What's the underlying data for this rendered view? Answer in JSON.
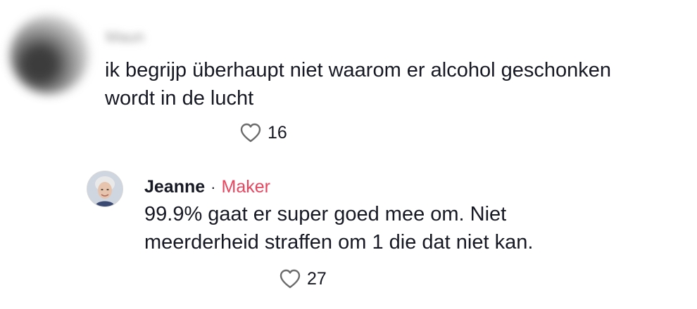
{
  "comments": [
    {
      "username": "Maun",
      "text_lines": [
        "ik begrijp überhaupt niet waarom er alcohol geschonken",
        "wordt in de lucht"
      ],
      "likes": "16",
      "avatar_icon": "user-avatar-blurred"
    },
    {
      "username": "Jeanne",
      "separator": "·",
      "badge": "Maker",
      "text_lines": [
        "99.9% gaat er super goed mee om. Niet",
        "meerderheid straffen om 1 die dat niet kan."
      ],
      "likes": "27",
      "avatar_icon": "user-avatar-photo"
    }
  ],
  "colors": {
    "text": "#161823",
    "creator_badge": "#e8455f",
    "heart_outline": "#6b6b6b"
  },
  "icons": {
    "like": "heart-outline-icon"
  }
}
